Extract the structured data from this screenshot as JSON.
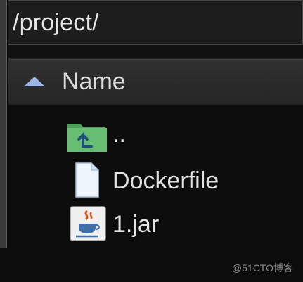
{
  "path_bar": {
    "path": "/project/"
  },
  "list_header": {
    "column_name": "Name",
    "sort_icon": "sort-ascending-icon"
  },
  "files": [
    {
      "name": "..",
      "icon": "parent-folder-icon"
    },
    {
      "name": "Dockerfile",
      "icon": "file-icon"
    },
    {
      "name": "1.jar",
      "icon": "java-jar-icon"
    }
  ],
  "watermark": {
    "text": "@51CTO博客"
  },
  "colors": {
    "background": "#0c0c0c",
    "header_bg": "#2c2c2c",
    "sort_arrow": "#9fb7e8",
    "folder_green": "#5fb868",
    "text": "#e2e2e2"
  }
}
